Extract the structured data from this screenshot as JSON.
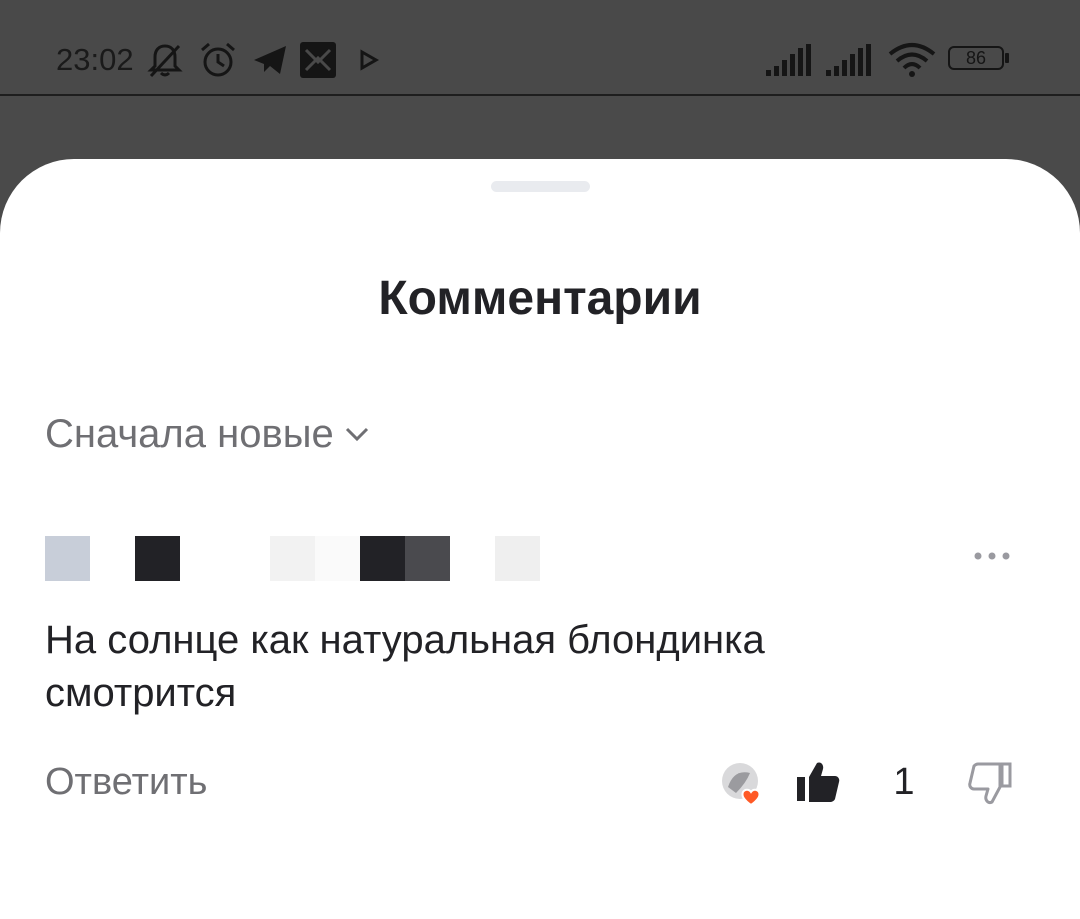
{
  "status_bar": {
    "time": "23:02",
    "battery": "86",
    "icons": [
      "bell-muted-icon",
      "alarm-icon",
      "telegram-icon",
      "app-icon",
      "play-icon",
      "signal-icon",
      "signal-icon",
      "wifi-icon",
      "battery-icon"
    ]
  },
  "sheet": {
    "title": "Комментарии",
    "sort": {
      "label": "Сначала новые",
      "icon": "chevron-down-icon"
    }
  },
  "comment": {
    "author_pixels": [
      "#c8ced9",
      "#ffffff",
      "#222226",
      "#ffffff",
      "#ffffff",
      "#f2f2f2",
      "#fafafa",
      "#222226",
      "#4a4a4e",
      "#ffffff",
      "#efefef"
    ],
    "text": "На солнце как натуральная блондинка смотрится",
    "reply_label": "Ответить",
    "like_count": "1",
    "menu_icon": "more-icon"
  },
  "colors": {
    "title": "#222226",
    "secondary_text": "#6f6f73",
    "reaction_heart": "#ff5a26",
    "background_dim": "#4a4a4a"
  }
}
